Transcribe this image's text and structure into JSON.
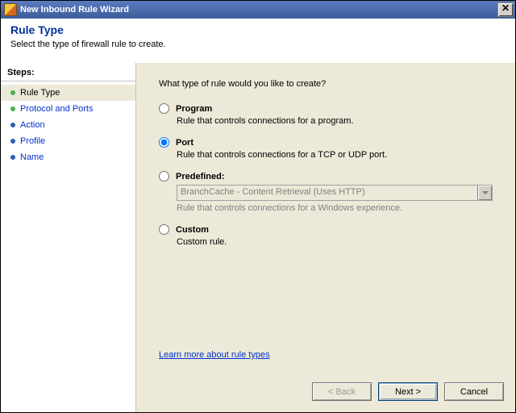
{
  "window": {
    "title": "New Inbound Rule Wizard"
  },
  "header": {
    "title": "Rule Type",
    "subtitle": "Select the type of firewall rule to create."
  },
  "sidebar": {
    "heading": "Steps:",
    "items": [
      {
        "label": "Rule Type",
        "current": true,
        "bullet": "green"
      },
      {
        "label": "Protocol and Ports",
        "current": false,
        "bullet": "green"
      },
      {
        "label": "Action",
        "current": false,
        "bullet": "blue"
      },
      {
        "label": "Profile",
        "current": false,
        "bullet": "blue"
      },
      {
        "label": "Name",
        "current": false,
        "bullet": "blue"
      }
    ]
  },
  "main": {
    "question": "What type of rule would you like to create?",
    "options": {
      "program": {
        "label": "Program",
        "desc": "Rule that controls connections for a program.",
        "selected": false
      },
      "port": {
        "label": "Port",
        "desc": "Rule that controls connections for a TCP or UDP port.",
        "selected": true
      },
      "predefined": {
        "label": "Predefined:",
        "select_value": "BranchCache - Content Retrieval (Uses HTTP)",
        "desc": "Rule that controls connections for a Windows experience.",
        "selected": false
      },
      "custom": {
        "label": "Custom",
        "desc": "Custom rule.",
        "selected": false
      }
    },
    "learn_link": "Learn more about rule types"
  },
  "buttons": {
    "back": "< Back",
    "next": "Next >",
    "cancel": "Cancel"
  }
}
